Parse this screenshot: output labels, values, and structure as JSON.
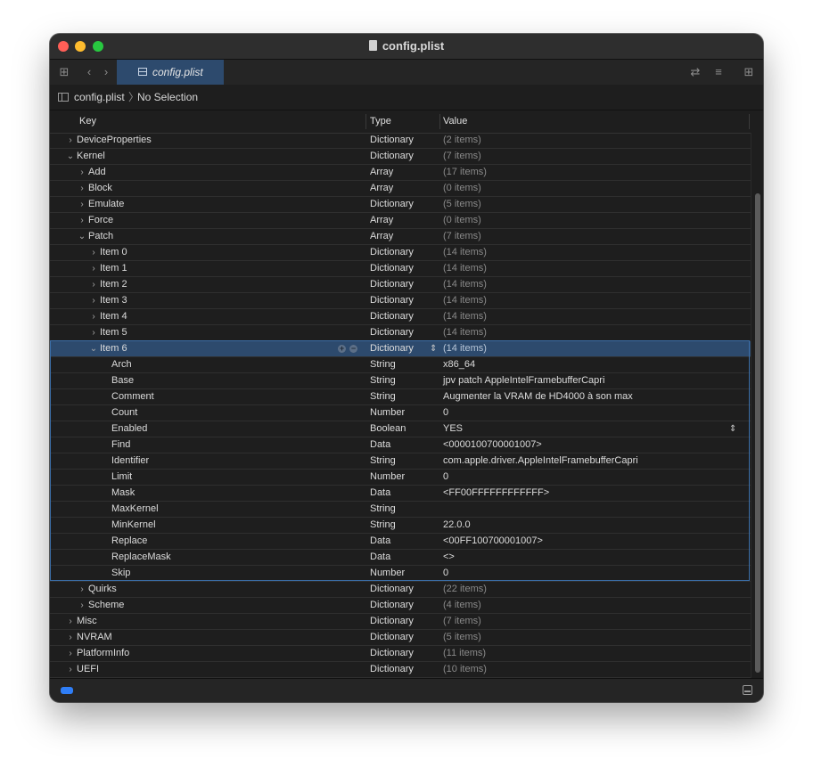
{
  "window": {
    "title": "config.plist"
  },
  "toolbar": {
    "tab_label": "config.plist",
    "icons": [
      "grid-icon",
      "back-icon",
      "forward-icon",
      "swap-icon",
      "lines-icon",
      "add-editor-icon"
    ]
  },
  "pathbar": {
    "file": "config.plist",
    "separator": "〉",
    "selection": "No Selection"
  },
  "columns": {
    "key": "Key",
    "type": "Type",
    "value": "Value"
  },
  "rows": [
    {
      "key": "DeviceProperties",
      "type": "Dictionary",
      "value": "(2 items)",
      "level": 0,
      "expander": "closed",
      "dim": true
    },
    {
      "key": "Kernel",
      "type": "Dictionary",
      "value": "(7 items)",
      "level": 0,
      "expander": "open",
      "dim": true
    },
    {
      "key": "Add",
      "type": "Array",
      "value": "(17 items)",
      "level": 1,
      "expander": "closed",
      "dim": true
    },
    {
      "key": "Block",
      "type": "Array",
      "value": "(0 items)",
      "level": 1,
      "expander": "closed",
      "dim": true
    },
    {
      "key": "Emulate",
      "type": "Dictionary",
      "value": "(5 items)",
      "level": 1,
      "expander": "closed",
      "dim": true
    },
    {
      "key": "Force",
      "type": "Array",
      "value": "(0 items)",
      "level": 1,
      "expander": "closed",
      "dim": true
    },
    {
      "key": "Patch",
      "type": "Array",
      "value": "(7 items)",
      "level": 1,
      "expander": "open",
      "dim": true
    },
    {
      "key": "Item 0",
      "type": "Dictionary",
      "value": "(14 items)",
      "level": 2,
      "expander": "closed",
      "dim": true
    },
    {
      "key": "Item 1",
      "type": "Dictionary",
      "value": "(14 items)",
      "level": 2,
      "expander": "closed",
      "dim": true
    },
    {
      "key": "Item 2",
      "type": "Dictionary",
      "value": "(14 items)",
      "level": 2,
      "expander": "closed",
      "dim": true
    },
    {
      "key": "Item 3",
      "type": "Dictionary",
      "value": "(14 items)",
      "level": 2,
      "expander": "closed",
      "dim": true
    },
    {
      "key": "Item 4",
      "type": "Dictionary",
      "value": "(14 items)",
      "level": 2,
      "expander": "closed",
      "dim": true
    },
    {
      "key": "Item 5",
      "type": "Dictionary",
      "value": "(14 items)",
      "level": 2,
      "expander": "closed",
      "dim": true
    },
    {
      "key": "Item 6",
      "type": "Dictionary",
      "value": "(14 items)",
      "level": 2,
      "expander": "open",
      "dim": true,
      "selected": true
    },
    {
      "key": "Arch",
      "type": "String",
      "value": "x86_64",
      "level": 3,
      "expander": "none"
    },
    {
      "key": "Base",
      "type": "String",
      "value": "jpv patch AppleIntelFramebufferCapri",
      "level": 3,
      "expander": "none"
    },
    {
      "key": "Comment",
      "type": "String",
      "value": "Augmenter la VRAM de HD4000 à son max",
      "level": 3,
      "expander": "none"
    },
    {
      "key": "Count",
      "type": "Number",
      "value": "0",
      "level": 3,
      "expander": "none"
    },
    {
      "key": "Enabled",
      "type": "Boolean",
      "value": "YES",
      "level": 3,
      "expander": "none",
      "stepper": true
    },
    {
      "key": "Find",
      "type": "Data",
      "value": "<0000100700001007>",
      "level": 3,
      "expander": "none"
    },
    {
      "key": "Identifier",
      "type": "String",
      "value": "com.apple.driver.AppleIntelFramebufferCapri",
      "level": 3,
      "expander": "none"
    },
    {
      "key": "Limit",
      "type": "Number",
      "value": "0",
      "level": 3,
      "expander": "none"
    },
    {
      "key": "Mask",
      "type": "Data",
      "value": "<FF00FFFFFFFFFFFF>",
      "level": 3,
      "expander": "none"
    },
    {
      "key": "MaxKernel",
      "type": "String",
      "value": "",
      "level": 3,
      "expander": "none"
    },
    {
      "key": "MinKernel",
      "type": "String",
      "value": "22.0.0",
      "level": 3,
      "expander": "none"
    },
    {
      "key": "Replace",
      "type": "Data",
      "value": "<00FF100700001007>",
      "level": 3,
      "expander": "none"
    },
    {
      "key": "ReplaceMask",
      "type": "Data",
      "value": "<>",
      "level": 3,
      "expander": "none"
    },
    {
      "key": "Skip",
      "type": "Number",
      "value": "0",
      "level": 3,
      "expander": "none"
    },
    {
      "key": "Quirks",
      "type": "Dictionary",
      "value": "(22 items)",
      "level": 1,
      "expander": "closed",
      "dim": true
    },
    {
      "key": "Scheme",
      "type": "Dictionary",
      "value": "(4 items)",
      "level": 1,
      "expander": "closed",
      "dim": true
    },
    {
      "key": "Misc",
      "type": "Dictionary",
      "value": "(7 items)",
      "level": 0,
      "expander": "closed",
      "dim": true
    },
    {
      "key": "NVRAM",
      "type": "Dictionary",
      "value": "(5 items)",
      "level": 0,
      "expander": "closed",
      "dim": true
    },
    {
      "key": "PlatformInfo",
      "type": "Dictionary",
      "value": "(11 items)",
      "level": 0,
      "expander": "closed",
      "dim": true
    },
    {
      "key": "UEFI",
      "type": "Dictionary",
      "value": "(10 items)",
      "level": 0,
      "expander": "closed",
      "dim": true
    }
  ],
  "colors": {
    "selection": "#2d4a6d",
    "accent": "#2f7ef7",
    "group_border": "#3b6ea8"
  }
}
